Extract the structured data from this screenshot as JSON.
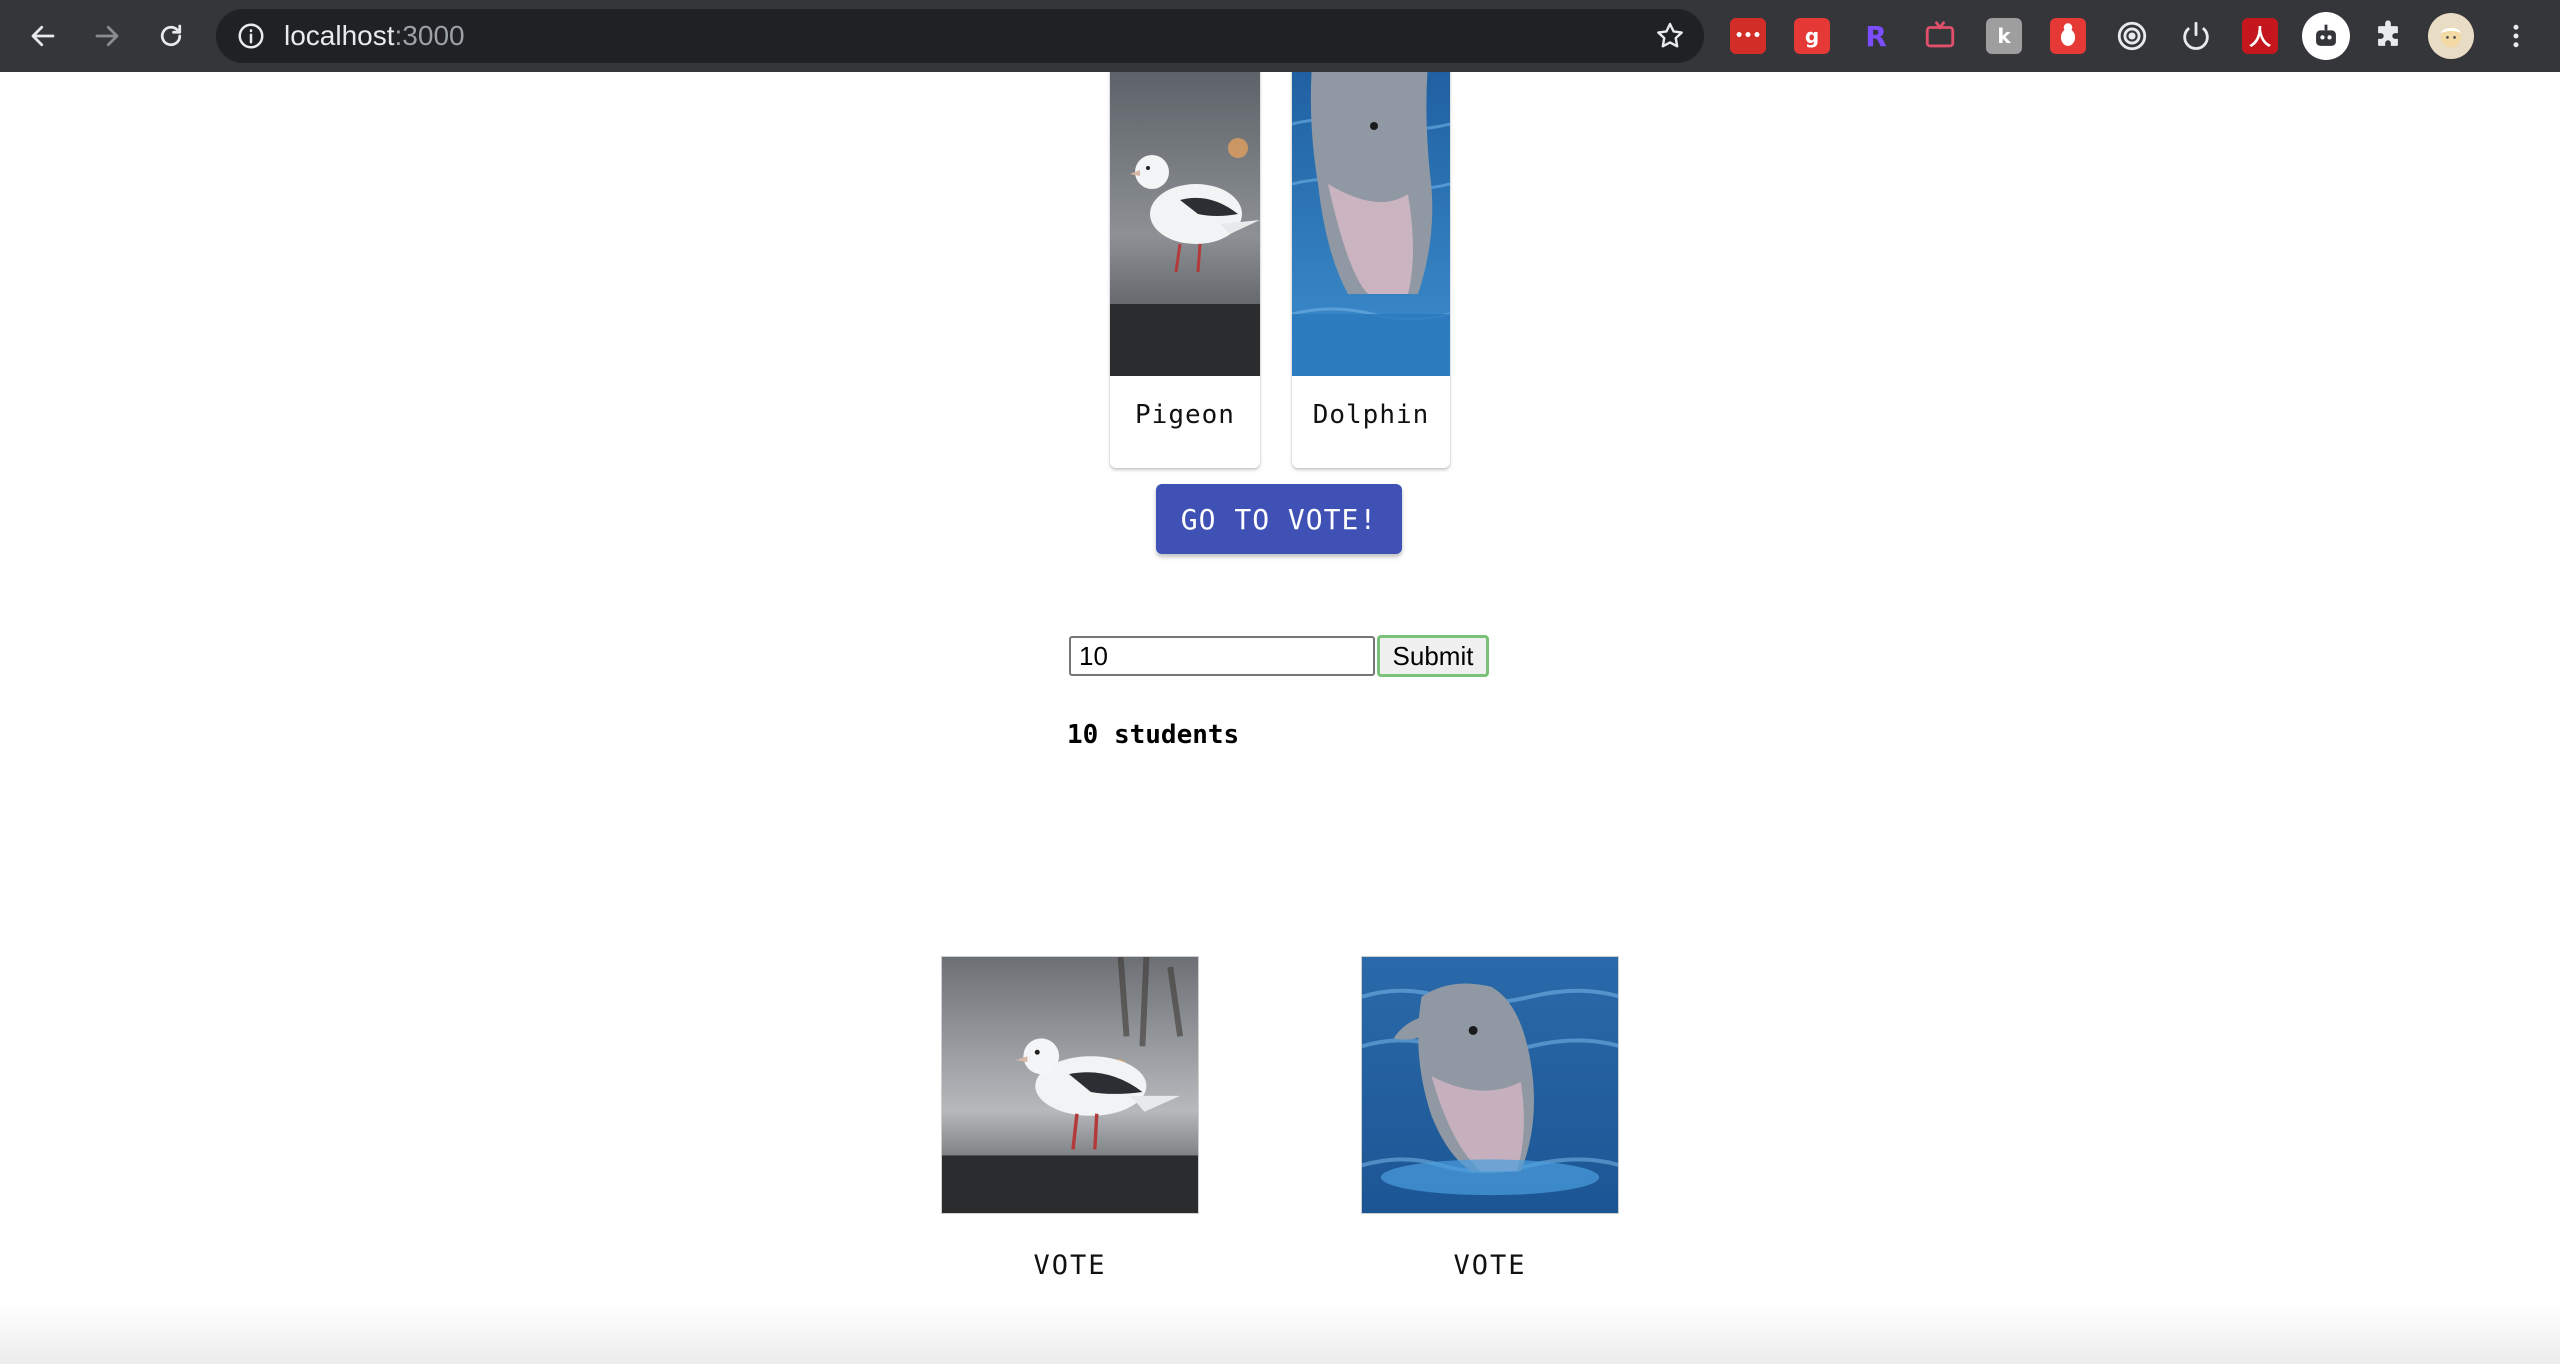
{
  "browser": {
    "url_host": "localhost",
    "url_port": ":3000",
    "extensions": [
      {
        "name": "lastpass-icon",
        "color": "#d32d27",
        "glyph": "•••"
      },
      {
        "name": "grammar-extension-icon",
        "color": "#e53935",
        "glyph": "g"
      },
      {
        "name": "r-extension-icon",
        "color": "transparent",
        "glyph": "R"
      },
      {
        "name": "tv-extension-icon",
        "color": "transparent",
        "glyph": ""
      },
      {
        "name": "k-extension-icon",
        "color": "#9e9e9e",
        "glyph": "k"
      },
      {
        "name": "bug-extension-icon",
        "color": "#e53935",
        "glyph": ""
      },
      {
        "name": "target-extension-icon",
        "color": "transparent",
        "glyph": ""
      },
      {
        "name": "power-extension-icon",
        "color": "transparent",
        "glyph": ""
      },
      {
        "name": "adobe-acrobat-icon",
        "color": "#c4161c",
        "glyph": "人"
      },
      {
        "name": "robot-extension-icon",
        "color": "transparent",
        "glyph": ""
      },
      {
        "name": "puzzle-extensions-icon",
        "color": "transparent",
        "glyph": ""
      },
      {
        "name": "profile-avatar-icon",
        "color": "transparent",
        "glyph": ""
      }
    ]
  },
  "cards": [
    {
      "label": "Pigeon",
      "image": "pigeon-image"
    },
    {
      "label": "Dolphin",
      "image": "dolphin-image"
    }
  ],
  "go_vote_label": "GO TO VOTE!",
  "student_form": {
    "value": "10",
    "submit_label": "Submit"
  },
  "students_text": "10 students",
  "vote_options": [
    {
      "label": "VOTE",
      "image": "pigeon-image"
    },
    {
      "label": "VOTE",
      "image": "dolphin-image"
    }
  ],
  "colors": {
    "chrome_bg": "#35363a",
    "omnibox_bg": "#202124",
    "primary_button": "#3f51b5",
    "submit_focus_ring": "#7ac27a"
  }
}
